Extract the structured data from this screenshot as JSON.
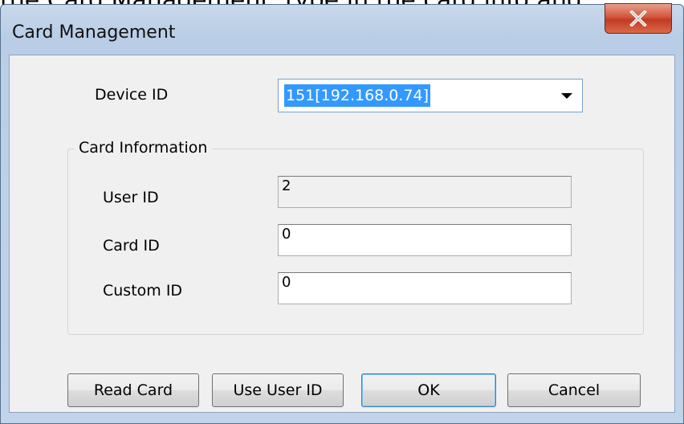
{
  "background_text": "the Card Management, type in the card info and ",
  "window": {
    "title": "Card Management",
    "close_icon": "close-icon",
    "close_glyph": "X"
  },
  "device": {
    "label": "Device ID",
    "value": "151[192.168.0.74]",
    "arrow_icon": "dropdown-arrow-icon"
  },
  "card_info": {
    "group_label": "Card Information",
    "user_id_label": "User ID",
    "user_id_value": "2",
    "card_id_label": "Card ID",
    "card_id_value": "0",
    "custom_id_label": "Custom ID",
    "custom_id_value": "0"
  },
  "buttons": {
    "read_card": "Read Card",
    "use_user_id": "Use User ID",
    "ok": "OK",
    "cancel": "Cancel"
  },
  "colors": {
    "selection": "#3399ff",
    "close_button": "#c23a22",
    "window_frame": "#b9cde6",
    "client_bg": "#f0f0f0"
  }
}
